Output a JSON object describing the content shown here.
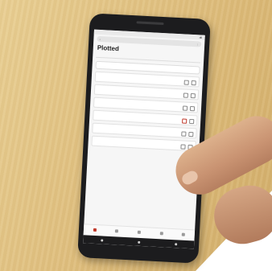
{
  "browser": {
    "url": "",
    "time": ""
  },
  "page": {
    "title": "Plotted",
    "subtitle": ""
  },
  "tabs": [
    {
      "label": ""
    },
    {
      "label": ""
    },
    {
      "label": ""
    },
    {
      "label": ""
    }
  ],
  "section_label": "",
  "search_placeholder": "",
  "cards": [
    {
      "label": "",
      "name": ""
    },
    {
      "label": "",
      "name": ""
    },
    {
      "label": "",
      "name": ""
    },
    {
      "label": "",
      "name": ""
    },
    {
      "label": "",
      "name": ""
    },
    {
      "label": "",
      "name": ""
    }
  ],
  "bottom_nav": [
    {
      "label": "",
      "icon": "home-icon"
    },
    {
      "label": "",
      "icon": "list-icon"
    },
    {
      "label": "",
      "icon": "map-icon"
    },
    {
      "label": "",
      "icon": "calendar-icon"
    },
    {
      "label": "",
      "icon": "profile-icon"
    }
  ],
  "colors": {
    "accent": "#c0392b",
    "table": "#dfc07f",
    "phone": "#1c1c1e"
  }
}
